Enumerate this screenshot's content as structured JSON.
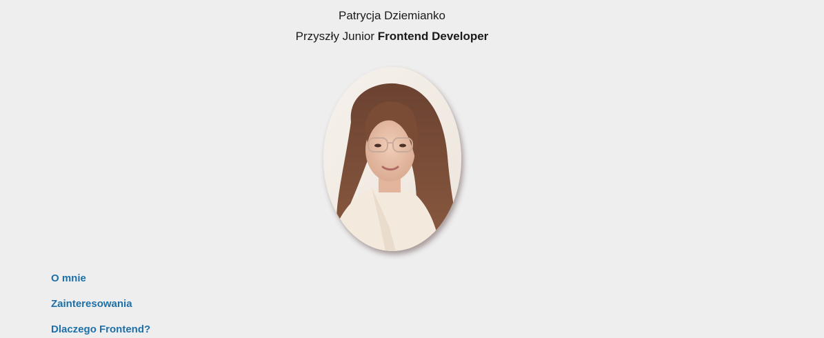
{
  "header": {
    "name": "Patrycja Dziemianko",
    "subtitle_prefix": "Przyszły Junior",
    "subtitle_role": "Frontend Developer"
  },
  "nav": {
    "items": [
      {
        "label": "O mnie"
      },
      {
        "label": "Zainteresowania"
      },
      {
        "label": "Dlaczego Frontend?"
      }
    ]
  },
  "colors": {
    "background": "#eeeeee",
    "link": "#1d6fa8",
    "text": "#1a1a1a"
  }
}
